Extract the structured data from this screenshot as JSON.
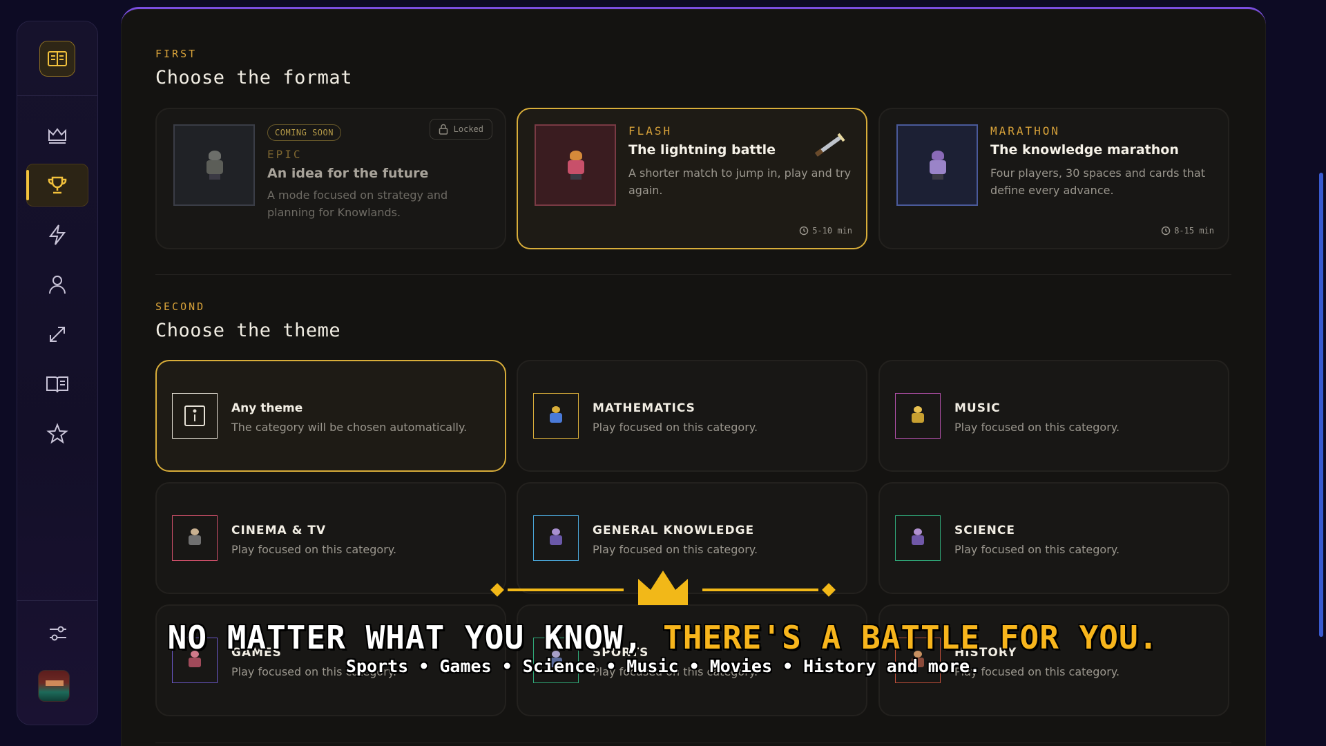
{
  "sidebar": {
    "icons": [
      "book-logo-icon",
      "crown-icon",
      "trophy-icon",
      "lightning-icon",
      "user-icon",
      "expand-icon",
      "open-book-icon",
      "star-icon",
      "sliders-icon"
    ]
  },
  "format_section": {
    "kicker": "FIRST",
    "title": "Choose the format",
    "cards": [
      {
        "badge": "COMING SOON",
        "lock_label": "Locked",
        "kicker": "EPIC",
        "title": "An idea for the future",
        "desc": "A mode focused on strategy and planning for Knowlands."
      },
      {
        "kicker": "FLASH",
        "title": "The lightning battle",
        "desc": "A shorter match to jump in, play and try again.",
        "time": "5-10 min"
      },
      {
        "kicker": "MARATHON",
        "title": "The knowledge marathon",
        "desc": "Four players, 30 spaces and cards that define every advance.",
        "time": "8-15 min"
      }
    ]
  },
  "theme_section": {
    "kicker": "SECOND",
    "title": "Choose the theme",
    "cards": [
      {
        "title": "Any theme",
        "desc": "The category will be chosen automatically.",
        "color": "#e6e1d6"
      },
      {
        "title": "MATHEMATICS",
        "desc": "Play focused on this category.",
        "color": "#d9ae3a"
      },
      {
        "title": "MUSIC",
        "desc": "Play focused on this category.",
        "color": "#b04fa8"
      },
      {
        "title": "CINEMA & TV",
        "desc": "Play focused on this category.",
        "color": "#d0506a"
      },
      {
        "title": "GENERAL KNOWLEDGE",
        "desc": "Play focused on this category.",
        "color": "#4aa6d8"
      },
      {
        "title": "SCIENCE",
        "desc": "Play focused on this category.",
        "color": "#2fa878"
      },
      {
        "title": "GAMES",
        "desc": "Play focused on this category.",
        "color": "#6a58c8"
      },
      {
        "title": "SPORTS",
        "desc": "Play focused on this category.",
        "color": "#2fa878"
      },
      {
        "title": "HISTORY",
        "desc": "Play focused on this category.",
        "color": "#c0503a"
      }
    ]
  },
  "banner": {
    "headline_white": "NO MATTER WHAT YOU KNOW, ",
    "headline_gold": "THERE'S A BATTLE FOR YOU.",
    "subline": "Sports • Games • Science • Music • Movies • History and more."
  },
  "colors": {
    "accent_gold": "#d9ae3a",
    "banner_gold": "#f2b818",
    "panel_border": "#7b4ee0"
  }
}
